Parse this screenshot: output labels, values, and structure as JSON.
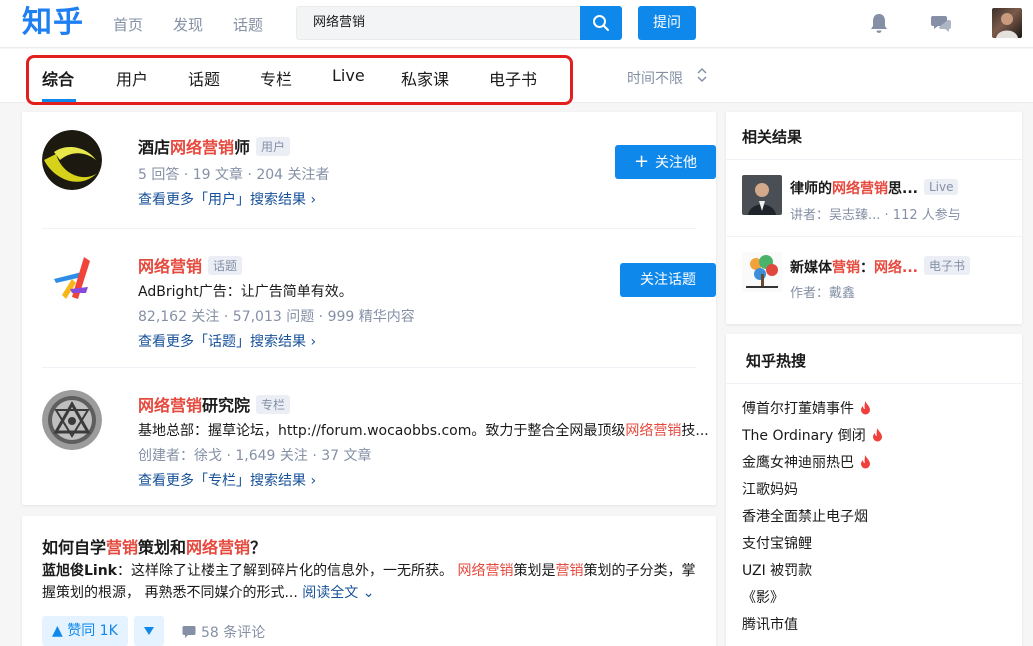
{
  "header": {
    "logo": "知乎",
    "nav": [
      "首页",
      "发现",
      "话题"
    ],
    "search_value": "网络营销",
    "ask_label": "提问"
  },
  "tabs": {
    "items": [
      "综合",
      "用户",
      "话题",
      "专栏",
      "Live",
      "私家课",
      "电子书"
    ],
    "active": "综合",
    "time_filter": "时间不限"
  },
  "results": [
    {
      "type": "user",
      "title_pre": "酒店",
      "title_hl": "网络营销",
      "title_post": "师",
      "badge": "用户",
      "meta": "5 回答 · 19 文章 · 204 关注者",
      "more": "查看更多「用户」搜索结果 ›",
      "button": "关注他"
    },
    {
      "type": "topic",
      "title_pre": "",
      "title_hl": "网络营销",
      "title_post": "",
      "badge": "话题",
      "desc": "AdBright广告：让广告简单有效。",
      "meta": "82,162 关注 · 57,013 问题 · 999 精华内容",
      "more": "查看更多「话题」搜索结果 ›",
      "button": "关注话题"
    },
    {
      "type": "column",
      "title_pre": "",
      "title_hl": "网络营销",
      "title_post": "研究院",
      "badge": "专栏",
      "desc_pre": "基地总部：握草论坛，http://forum.wocaobbs.com。致力于整合全网最顶级",
      "desc_hl": "网络营销",
      "desc_post": "技...",
      "meta": "创建者：徐戈 · 1,649 关注 · 37 文章",
      "more": "查看更多「专栏」搜索结果 ›"
    }
  ],
  "question": {
    "t1": "如何自学",
    "t2": "营销",
    "t3": "策划和",
    "t4": "网络营销",
    "t5": "？",
    "author": "蓝旭俊Link",
    "e1": "：这样除了让楼主了解到碎片化的信息外，一无所获。 ",
    "e2": "网络营销",
    "e3": "策划是",
    "e4": "营销",
    "e5": "策划的子分类，掌握策划的根源， 再熟悉不同媒介的形式... ",
    "read_all": "阅读全文 ⌄",
    "vote": "▲ 赞同 1K",
    "comments": "58 条评论"
  },
  "related": {
    "heading": "相关结果",
    "items": [
      {
        "title_pre": "律师的",
        "title_hl": "网络营销",
        "title_post": "思...",
        "badge": "Live",
        "sub": "讲者：吴志臻... · 112 人参与"
      },
      {
        "title_pre": "新媒体",
        "title_hl": "营销",
        "title_mid": "：",
        "title_hl2": "网络...",
        "badge": "电子书",
        "sub": "作者：戴鑫"
      }
    ]
  },
  "hot": {
    "heading": "知乎热搜",
    "items": [
      {
        "label": "傅首尔打董婧事件",
        "hot": true
      },
      {
        "label": "The Ordinary 倒闭",
        "hot": true
      },
      {
        "label": "金鹰女神迪丽热巴",
        "hot": true
      },
      {
        "label": "江歌妈妈",
        "hot": false
      },
      {
        "label": "香港全面禁止电子烟",
        "hot": false
      },
      {
        "label": "支付宝锦鲤",
        "hot": false
      },
      {
        "label": "UZI 被罚款",
        "hot": false
      },
      {
        "label": "《影》",
        "hot": false
      },
      {
        "label": "腾讯市值",
        "hot": false
      }
    ]
  },
  "colors": {
    "brand": "#0f88eb",
    "highlight": "#e64a3f",
    "annotation": "#e21f1f",
    "muted": "#8590a6",
    "link": "#175199"
  }
}
